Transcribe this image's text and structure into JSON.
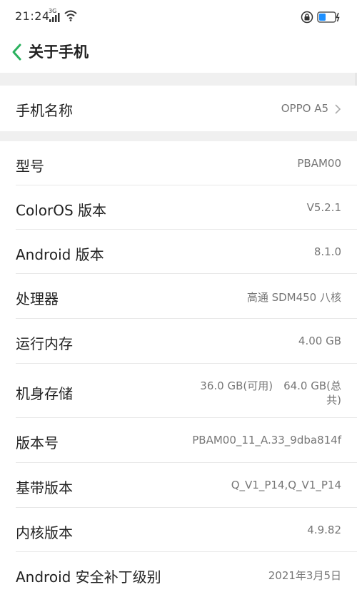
{
  "status_bar": {
    "time": "21:24",
    "network": "3G",
    "icons": [
      "signal-icon",
      "wifi-icon",
      "lock-icon",
      "battery-icon"
    ]
  },
  "header": {
    "back_icon": "back-arrow-icon",
    "title": "关于手机"
  },
  "device_name": {
    "label": "手机名称",
    "value": "OPPO A5",
    "chevron": "chevron-right-icon"
  },
  "info_rows": [
    {
      "label": "型号",
      "value": "PBAM00"
    },
    {
      "label": "ColorOS 版本",
      "value": "V5.2.1"
    },
    {
      "label": "Android 版本",
      "value": "8.1.0"
    },
    {
      "label": "处理器",
      "value": "高通 SDM450 八核"
    },
    {
      "label": "运行内存",
      "value": "4.00 GB"
    },
    {
      "label": "机身存储",
      "value_line1": "36.0 GB(可用)　64.0 GB(总",
      "value_line2": "共)"
    },
    {
      "label": "版本号",
      "value": "PBAM00_11_A.33_9dba814f"
    },
    {
      "label": "基带版本",
      "value": "Q_V1_P14,Q_V1_P14"
    },
    {
      "label": "内核版本",
      "value": "4.9.82"
    },
    {
      "label": "Android 安全补丁级别",
      "value": "2021年3月5日"
    }
  ],
  "colors": {
    "accent": "#2bb15e",
    "background": "#ffffff",
    "section_gap": "#f0f0f0",
    "label_text": "#222222",
    "value_text": "#777777"
  }
}
